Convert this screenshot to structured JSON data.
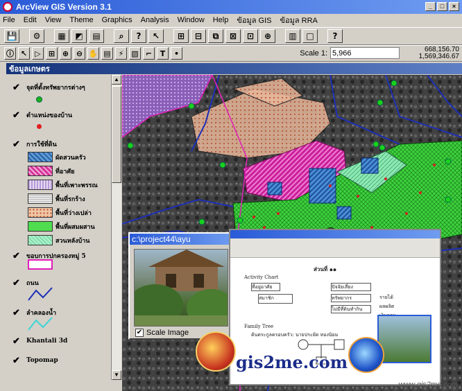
{
  "window": {
    "title": "ArcView GIS Version 3.1",
    "controls": [
      "_",
      "□",
      "×"
    ]
  },
  "menu": [
    "File",
    "Edit",
    "View",
    "Theme",
    "Graphics",
    "Analysis",
    "Window",
    "Help",
    "ข้อมูล GIS",
    "ข้อมูล RRA"
  ],
  "toolbar1": [
    "💾",
    "⚙",
    "▦",
    "◩",
    "▤",
    "⌕",
    "?",
    "↖",
    "⊞",
    "⊟",
    "⧉",
    "⊠",
    "⊡",
    "⊕",
    "▥",
    "□",
    "?"
  ],
  "toolbar2": [
    "ⓘ",
    "↖",
    "▷",
    "⊞",
    "⊕",
    "⊖",
    "✋",
    "▤",
    "⚡",
    "▧",
    "⌐",
    "T",
    "•"
  ],
  "scale": {
    "label": "Scale 1:",
    "value": "5,966"
  },
  "coords": {
    "x": "668,156.70",
    "y": "1,569,346.67"
  },
  "view": {
    "title": "ข้อมูลเกษตร"
  },
  "toc": {
    "layers": [
      {
        "name": "จุดที่ตั้งทรัพยากรต่างๆ",
        "checked": "✔"
      },
      {
        "name": "ตำแหน่งของบ้าน",
        "checked": "✔"
      },
      {
        "name": "การใช้ที่ดิน",
        "checked": "✔"
      },
      {
        "name": "ขอบการปกครองหมู่ 5",
        "checked": "✔"
      },
      {
        "name": "ถนน",
        "checked": "✔"
      },
      {
        "name": "ลำคลองน้ำ",
        "checked": "✔"
      },
      {
        "name": "Khantali 3d",
        "checked": "✔"
      },
      {
        "name": "Topomap",
        "checked": "✔"
      }
    ],
    "landuse_legend": [
      {
        "label": "ผัดสวนครัว",
        "color": "#5b9bd5"
      },
      {
        "label": "ที่อาศัย",
        "color": "#d6339a"
      },
      {
        "label": "พื้นที่เพาะพรรณ",
        "color": "#b69ad8"
      },
      {
        "label": "พื้นที่รกร้าง",
        "color": "#e6e6e6"
      },
      {
        "label": "พื้นที่ว่างเปล่า",
        "color": "#f0c8a8"
      },
      {
        "label": "พื้นที่ผสมผสาน",
        "color": "#4fdc4f"
      },
      {
        "label": "สวนหลังบ้าน",
        "color": "#a8f0c8"
      }
    ]
  },
  "subwindow": {
    "title": "c:\\project44\\ayu",
    "checkbox": "✔",
    "scale_label": "Scale Image"
  },
  "document": {
    "heading": "ส่วนที่ ๑๑",
    "activity_chart": "Activity Chart",
    "family_tree": "Family Tree",
    "family_note": "ต้นตระกูลครอบครัว: นายประยัด ทองนิยม",
    "boxes": [
      "ที่อยู่อาศัย",
      "สมาชิก",
      "ปัจจัยเสี่ยง",
      "ทรัพยากร",
      "ไม่มีที่ดินทำกิน"
    ],
    "side_notes": [
      "รายได้",
      "ผลผลิต",
      "เงินออม"
    ]
  },
  "watermark": {
    "brand": "gis2me.com",
    "url": "www.gis2me.com"
  }
}
